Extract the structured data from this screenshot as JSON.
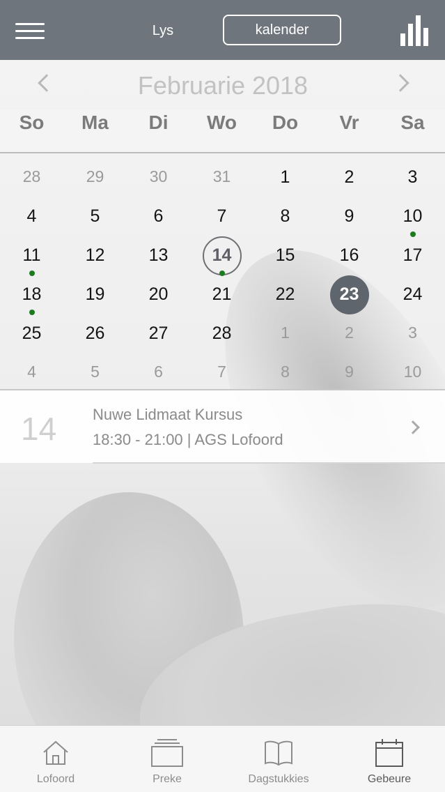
{
  "topbar": {
    "list_label": "Lys",
    "calendar_label": "kalender"
  },
  "calendar": {
    "month_title": "Februarie 2018",
    "weekdays": [
      "So",
      "Ma",
      "Di",
      "Wo",
      "Do",
      "Vr",
      "Sa"
    ],
    "weeks": [
      [
        {
          "d": "28",
          "m": true
        },
        {
          "d": "29",
          "m": true
        },
        {
          "d": "30",
          "m": true
        },
        {
          "d": "31",
          "m": true
        },
        {
          "d": "1"
        },
        {
          "d": "2"
        },
        {
          "d": "3"
        }
      ],
      [
        {
          "d": "4"
        },
        {
          "d": "5"
        },
        {
          "d": "6"
        },
        {
          "d": "7"
        },
        {
          "d": "8"
        },
        {
          "d": "9"
        },
        {
          "d": "10",
          "dot": true
        }
      ],
      [
        {
          "d": "11",
          "dot": true
        },
        {
          "d": "12"
        },
        {
          "d": "13"
        },
        {
          "d": "14",
          "today": true,
          "dot": true
        },
        {
          "d": "15"
        },
        {
          "d": "16"
        },
        {
          "d": "17"
        }
      ],
      [
        {
          "d": "18",
          "dot": true
        },
        {
          "d": "19"
        },
        {
          "d": "20"
        },
        {
          "d": "21"
        },
        {
          "d": "22"
        },
        {
          "d": "23",
          "selected": true
        },
        {
          "d": "24"
        }
      ],
      [
        {
          "d": "25"
        },
        {
          "d": "26"
        },
        {
          "d": "27"
        },
        {
          "d": "28"
        },
        {
          "d": "1",
          "m": true
        },
        {
          "d": "2",
          "m": true
        },
        {
          "d": "3",
          "m": true
        }
      ],
      [
        {
          "d": "4",
          "m": true
        },
        {
          "d": "5",
          "m": true
        },
        {
          "d": "6",
          "m": true
        },
        {
          "d": "7",
          "m": true
        },
        {
          "d": "8",
          "m": true
        },
        {
          "d": "9",
          "m": true
        },
        {
          "d": "10",
          "m": true
        }
      ]
    ]
  },
  "event": {
    "day": "14",
    "title": "Nuwe Lidmaat Kursus",
    "meta": "18:30 - 21:00 | AGS Lofoord"
  },
  "tabs": [
    {
      "label": "Lofoord",
      "icon": "home-icon"
    },
    {
      "label": "Preke",
      "icon": "stack-icon"
    },
    {
      "label": "Dagstukkies",
      "icon": "book-icon"
    },
    {
      "label": "Gebeure",
      "icon": "calendar-icon",
      "active": true
    }
  ],
  "colors": {
    "header": "#6f757c",
    "event_dot": "#1e7a1e",
    "selected_day": "#5f656c"
  }
}
